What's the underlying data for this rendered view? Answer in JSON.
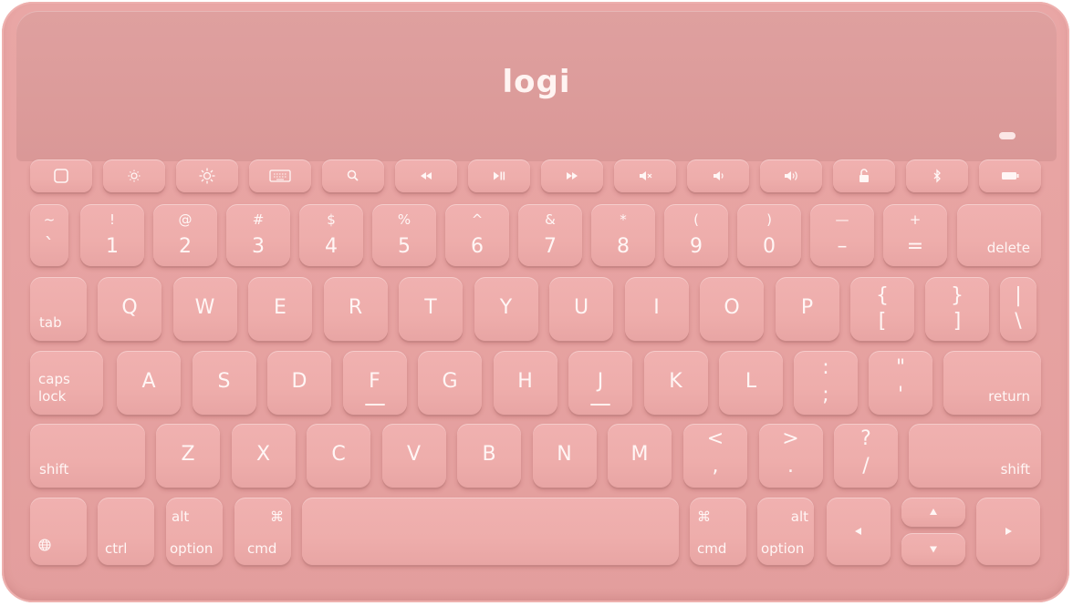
{
  "brand": {
    "logo_text": "logi"
  },
  "function_row": [
    "home-icon",
    "brightness-down-icon",
    "brightness-up-icon",
    "keyboard-icon",
    "search-icon",
    "rewind-icon",
    "play-pause-icon",
    "fast-forward-icon",
    "mute-icon",
    "volume-down-icon",
    "volume-up-icon",
    "lock-icon",
    "bluetooth-icon",
    "battery-icon"
  ],
  "number_row": [
    {
      "top": "~",
      "bottom": "`"
    },
    {
      "top": "!",
      "bottom": "1"
    },
    {
      "top": "@",
      "bottom": "2"
    },
    {
      "top": "#",
      "bottom": "3"
    },
    {
      "top": "$",
      "bottom": "4"
    },
    {
      "top": "%",
      "bottom": "5"
    },
    {
      "top": "^",
      "bottom": "6"
    },
    {
      "top": "&",
      "bottom": "7"
    },
    {
      "top": "*",
      "bottom": "8"
    },
    {
      "top": "(",
      "bottom": "9"
    },
    {
      "top": ")",
      "bottom": "0"
    },
    {
      "top": "—",
      "bottom": "–"
    },
    {
      "top": "+",
      "bottom": "="
    }
  ],
  "delete_label": "delete",
  "tab_label": "tab",
  "qwerty_row": [
    "Q",
    "W",
    "E",
    "R",
    "T",
    "Y",
    "U",
    "I",
    "O",
    "P"
  ],
  "qwerty_symbols": [
    {
      "top": "{",
      "bottom": "["
    },
    {
      "top": "}",
      "bottom": "]"
    },
    {
      "top": "|",
      "bottom": "\\"
    }
  ],
  "caps_label_1": "caps",
  "caps_label_2": "lock",
  "home_row": [
    "A",
    "S",
    "D",
    "F",
    "G",
    "H",
    "J",
    "K",
    "L"
  ],
  "home_symbols": [
    {
      "top": ":",
      "bottom": ";"
    },
    {
      "top": "\"",
      "bottom": "'"
    }
  ],
  "return_label": "return",
  "shift_label": "shift",
  "bottom_letters": [
    "Z",
    "X",
    "C",
    "V",
    "B",
    "N",
    "M"
  ],
  "bottom_symbols": [
    {
      "top": "<",
      "bottom": ","
    },
    {
      "top": ">",
      "bottom": "."
    },
    {
      "top": "?",
      "bottom": "/"
    }
  ],
  "mod_row": {
    "ctrl": "ctrl",
    "alt": "alt",
    "option": "option",
    "cmd": "cmd",
    "cmd_symbol": "⌘"
  }
}
